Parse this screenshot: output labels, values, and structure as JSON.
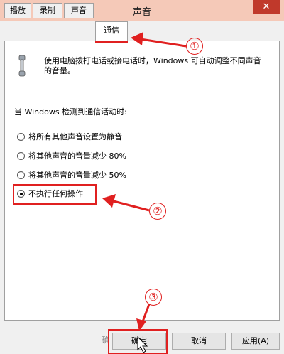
{
  "window": {
    "title": "声音",
    "close_label": "✕"
  },
  "tabs": [
    {
      "label": "播放"
    },
    {
      "label": "录制"
    },
    {
      "label": "声音"
    },
    {
      "label": "通信"
    }
  ],
  "communication": {
    "description": "使用电脑拨打电话或接电话时，Windows 可自动调整不同声音的音量。",
    "section_label": "当 Windows 检测到通信活动时:",
    "options": [
      {
        "label": "将所有其他声音设置为静音",
        "selected": false
      },
      {
        "label": "将其他声音的音量减少 80%",
        "selected": false
      },
      {
        "label": "将其他声音的音量减少 50%",
        "selected": false
      },
      {
        "label": "不执行任何操作",
        "selected": true
      }
    ]
  },
  "buttons": {
    "ok_label": "确定",
    "cancel_label": "取消",
    "apply_label": "应用(A)",
    "partial_label": "确"
  },
  "annotations": {
    "one": "①",
    "two": "②",
    "three": "③",
    "color": "#e02020"
  },
  "colors": {
    "titlebar": "#f5c9b8",
    "close_button": "#c0392b",
    "annotation_red": "#e02020"
  },
  "icons": {
    "phone": "telephone-handset-icon",
    "close": "close-icon",
    "cursor": "mouse-cursor-icon"
  }
}
